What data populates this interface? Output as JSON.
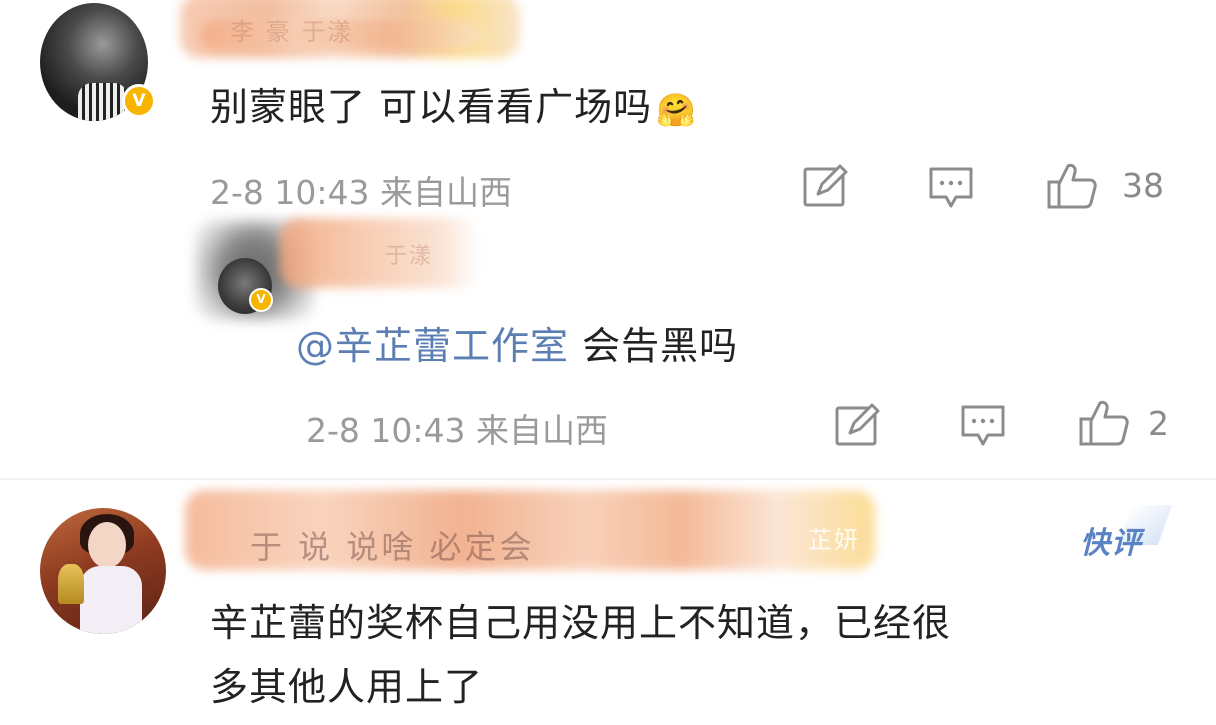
{
  "comment1": {
    "name_blurred": "李 豪 于漾",
    "verified_badge": "V",
    "text": "别蒙眼了 可以看看广场吗",
    "emoji": "🤗",
    "meta": "2-8 10:43 来自山西",
    "like_count": "38"
  },
  "reply": {
    "name_blurred": "于漾",
    "verified_badge": "V",
    "mention": "@辛芷蕾工作室",
    "text": " 会告黑吗",
    "meta": "2-8 10:43 来自山西",
    "like_count": "2"
  },
  "comment2": {
    "name_blurred": "于 说 说啥 必定会",
    "badge_blurred": "芷妍",
    "tag": "快评",
    "text_line1": "辛芷蕾的奖杯自己用没用上不知道，已经很",
    "text_line2": "多其他人用上了"
  },
  "icons": {
    "share": "edit-share-icon",
    "comment": "comment-bubble-icon",
    "like": "thumbs-up-icon"
  },
  "colors": {
    "mention": "#5b7fb3",
    "badge": "#f7b500",
    "tag": "#5a83c4"
  }
}
